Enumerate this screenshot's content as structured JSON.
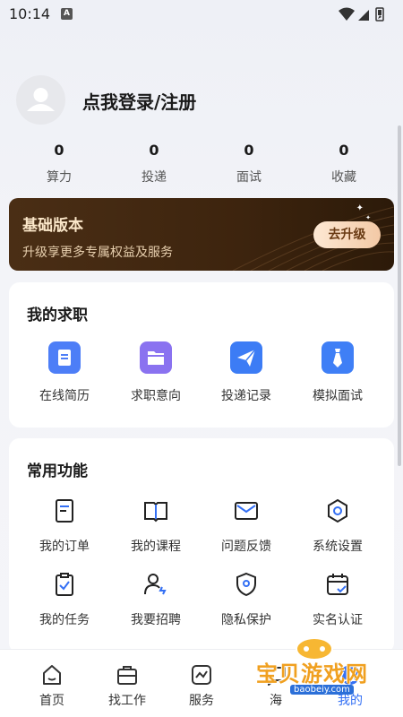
{
  "status_bar": {
    "time": "10:14",
    "notification_letter": "A"
  },
  "profile": {
    "login_text": "点我登录/注册"
  },
  "stats": [
    {
      "value": "0",
      "label": "算力"
    },
    {
      "value": "0",
      "label": "投递"
    },
    {
      "value": "0",
      "label": "面试"
    },
    {
      "value": "0",
      "label": "收藏"
    }
  ],
  "vip": {
    "title": "基础版本",
    "subtitle": "升级享更多专属权益及服务",
    "button": "去升级"
  },
  "job_section": {
    "title": "我的求职",
    "items": [
      {
        "label": "在线简历",
        "icon": "resume-icon",
        "color": "#4d7ef7"
      },
      {
        "label": "求职意向",
        "icon": "folder-icon",
        "color": "#8a72f0"
      },
      {
        "label": "投递记录",
        "icon": "send-icon",
        "color": "#3c7cf5"
      },
      {
        "label": "模拟面试",
        "icon": "tie-icon",
        "color": "#3f7ff6"
      }
    ]
  },
  "functions_section": {
    "title": "常用功能",
    "items": [
      {
        "label": "我的订单",
        "icon": "order-icon"
      },
      {
        "label": "我的课程",
        "icon": "book-icon"
      },
      {
        "label": "问题反馈",
        "icon": "mail-icon"
      },
      {
        "label": "系统设置",
        "icon": "settings-icon"
      },
      {
        "label": "我的任务",
        "icon": "task-icon"
      },
      {
        "label": "我要招聘",
        "icon": "recruit-icon"
      },
      {
        "label": "隐私保护",
        "icon": "privacy-icon"
      },
      {
        "label": "实名认证",
        "icon": "verify-icon"
      }
    ]
  },
  "bottom_nav": [
    {
      "label": "首页",
      "icon": "home-icon"
    },
    {
      "label": "找工作",
      "icon": "briefcase-icon"
    },
    {
      "label": "服务",
      "icon": "service-icon"
    },
    {
      "label": "海",
      "icon": "chat-icon"
    },
    {
      "label": "我的",
      "icon": "profile-icon"
    }
  ],
  "watermark": {
    "text": "宝贝游戏网",
    "url": "baobeiy.com"
  },
  "colors": {
    "accent": "#3470f4",
    "vip_bg": "#3d240e",
    "vip_button": "#f3c9a6"
  }
}
